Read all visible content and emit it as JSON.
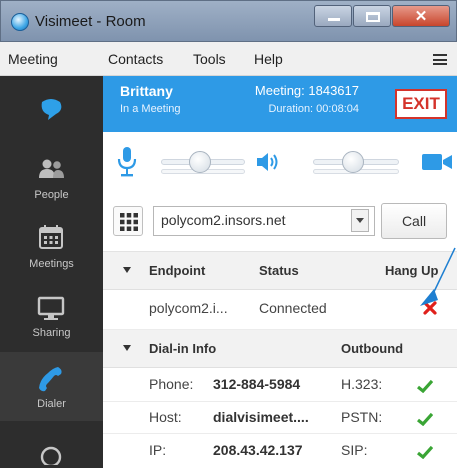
{
  "window": {
    "title": "Visimeet - Room",
    "close_glyph": "✕"
  },
  "menu": [
    "Meeting",
    "Contacts",
    "Tools",
    "Help"
  ],
  "nav": [
    {
      "label": "",
      "icon": "chat-bubble-icon"
    },
    {
      "label": "People",
      "icon": "people-icon"
    },
    {
      "label": "Meetings",
      "icon": "calendar-icon"
    },
    {
      "label": "Sharing",
      "icon": "monitor-icon"
    },
    {
      "label": "Dialer",
      "icon": "phone-icon"
    }
  ],
  "header": {
    "name": "Brittany",
    "state": "In a Meeting",
    "meeting": "Meeting: 1843617",
    "duration": "Duration: 00:08:04",
    "exit_label": "EXIT",
    "color": "#2e9ae6"
  },
  "audio": {
    "mic_level": 0.45,
    "speaker_level": 0.45
  },
  "dialer": {
    "address": "polycom2.insors.net",
    "call_label": "Call"
  },
  "endpoints": {
    "headers": [
      "Endpoint",
      "Status",
      "Hang Up"
    ],
    "rows": [
      {
        "endpoint": "polycom2.i...",
        "status": "Connected"
      }
    ]
  },
  "dialin": {
    "headers": [
      "Dial-in Info",
      "Outbound"
    ],
    "rows": [
      {
        "label": "Phone:",
        "value": "312-884-5984",
        "proto": "H.323:"
      },
      {
        "label": "Host:",
        "value": "dialvisimeet....",
        "proto": "PSTN:"
      },
      {
        "label": "IP:",
        "value": "208.43.42.137",
        "proto": "SIP:"
      }
    ]
  },
  "colors": {
    "ok": "#3aa535",
    "hangup": "#e0201b",
    "annotation": "#1e7fd1"
  }
}
